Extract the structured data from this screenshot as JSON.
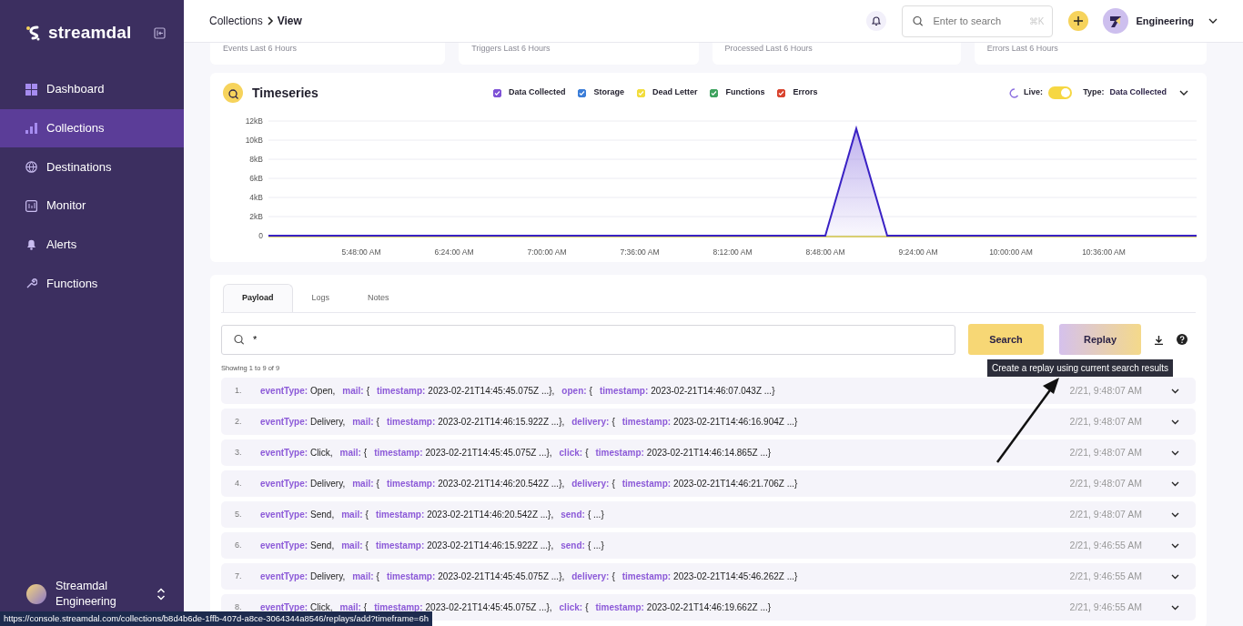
{
  "sidebar": {
    "brand": "streamdal",
    "items": [
      {
        "label": "Dashboard",
        "selected": false
      },
      {
        "label": "Collections",
        "selected": true
      },
      {
        "label": "Destinations",
        "selected": false
      },
      {
        "label": "Monitor",
        "selected": false
      },
      {
        "label": "Alerts",
        "selected": false
      },
      {
        "label": "Functions",
        "selected": false
      }
    ],
    "account": {
      "name": "Streamdal",
      "team": "Engineering"
    }
  },
  "header": {
    "breadcrumb": [
      "Collections",
      "View"
    ],
    "search": {
      "placeholder": "Enter to search",
      "shortcut": "⌘K"
    },
    "team": "Engineering"
  },
  "stats": [
    {
      "label": "Events Last 6 Hours"
    },
    {
      "label": "Triggers Last 6 Hours"
    },
    {
      "label": "Processed Last 6 Hours"
    },
    {
      "label": "Errors Last 6 Hours"
    }
  ],
  "timeseries": {
    "title": "Timeseries",
    "legend": [
      {
        "label": "Data Collected",
        "checked": true,
        "color": "#7e52d6"
      },
      {
        "label": "Storage",
        "checked": true,
        "color": "#3b7dd8"
      },
      {
        "label": "Dead Letter",
        "checked": true,
        "color": "#f2dd3c"
      },
      {
        "label": "Functions",
        "checked": true,
        "color": "#3fa35f"
      },
      {
        "label": "Errors",
        "checked": true,
        "color": "#d9442f"
      }
    ],
    "live": {
      "label": "Live:",
      "on": true
    },
    "type": {
      "label": "Type:",
      "value": "Data Collected"
    },
    "chart_data": {
      "type": "area",
      "x": [
        312,
        528,
        540,
        552,
        672
      ],
      "grid": true,
      "series": [
        {
          "color": "#3a22c4",
          "values": [
            0,
            0,
            11.2,
            0,
            0
          ]
        }
      ],
      "xlim": [
        312,
        672
      ],
      "ylim": [
        0,
        12
      ],
      "xticks": [
        {
          "value": 348,
          "label": "5:48:00 AM"
        },
        {
          "value": 384,
          "label": "6:24:00 AM"
        },
        {
          "value": 420,
          "label": "7:00:00 AM"
        },
        {
          "value": 456,
          "label": "7:36:00 AM"
        },
        {
          "value": 492,
          "label": "8:12:00 AM"
        },
        {
          "value": 528,
          "label": "8:48:00 AM"
        },
        {
          "value": 564,
          "label": "9:24:00 AM"
        },
        {
          "value": 600,
          "label": "10:00:00 AM"
        },
        {
          "value": 636,
          "label": "10:36:00 AM"
        }
      ],
      "yticks": [
        {
          "value": 0,
          "label": "0"
        },
        {
          "value": 2,
          "label": "2kB"
        },
        {
          "value": 4,
          "label": "4kB"
        },
        {
          "value": 6,
          "label": "6kB"
        },
        {
          "value": 8,
          "label": "8kB"
        },
        {
          "value": 10,
          "label": "10kB"
        },
        {
          "value": 12,
          "label": "12kB"
        }
      ]
    }
  },
  "payload": {
    "tabs": [
      {
        "label": "Payload",
        "selected": true
      },
      {
        "label": "Logs",
        "selected": false
      },
      {
        "label": "Notes",
        "selected": false
      }
    ],
    "search": {
      "value": "*"
    },
    "search_button": "Search",
    "replay_button": "Replay",
    "tooltip": "Create a replay using current search results",
    "showing": "Showing 1 to 9 of 9",
    "rows": [
      {
        "number": "1.",
        "segments": [
          {
            "kind": "key",
            "text": "eventType:"
          },
          {
            "kind": "value",
            "text": "Open,"
          },
          {
            "kind": "key",
            "text": "mail:"
          },
          {
            "kind": "value",
            "text": "{"
          },
          {
            "kind": "key",
            "text": "timestamp:"
          },
          {
            "kind": "value",
            "text": "2023-02-21T14:45:45.075Z ...},"
          },
          {
            "kind": "key",
            "text": "open:"
          },
          {
            "kind": "value",
            "text": "{"
          },
          {
            "kind": "key",
            "text": "timestamp:"
          },
          {
            "kind": "value",
            "text": "2023-02-21T14:46:07.043Z ...}"
          }
        ],
        "time": "2/21, 9:48:07 AM"
      },
      {
        "number": "2.",
        "segments": [
          {
            "kind": "key",
            "text": "eventType:"
          },
          {
            "kind": "value",
            "text": "Delivery,"
          },
          {
            "kind": "key",
            "text": "mail:"
          },
          {
            "kind": "value",
            "text": "{"
          },
          {
            "kind": "key",
            "text": "timestamp:"
          },
          {
            "kind": "value",
            "text": "2023-02-21T14:46:15.922Z ...},"
          },
          {
            "kind": "key",
            "text": "delivery:"
          },
          {
            "kind": "value",
            "text": "{"
          },
          {
            "kind": "key",
            "text": "timestamp:"
          },
          {
            "kind": "value",
            "text": "2023-02-21T14:46:16.904Z ...}"
          }
        ],
        "time": "2/21, 9:48:07 AM"
      },
      {
        "number": "3.",
        "segments": [
          {
            "kind": "key",
            "text": "eventType:"
          },
          {
            "kind": "value",
            "text": "Click,"
          },
          {
            "kind": "key",
            "text": "mail:"
          },
          {
            "kind": "value",
            "text": "{"
          },
          {
            "kind": "key",
            "text": "timestamp:"
          },
          {
            "kind": "value",
            "text": "2023-02-21T14:45:45.075Z ...},"
          },
          {
            "kind": "key",
            "text": "click:"
          },
          {
            "kind": "value",
            "text": "{"
          },
          {
            "kind": "key",
            "text": "timestamp:"
          },
          {
            "kind": "value",
            "text": "2023-02-21T14:46:14.865Z ...}"
          }
        ],
        "time": "2/21, 9:48:07 AM"
      },
      {
        "number": "4.",
        "segments": [
          {
            "kind": "key",
            "text": "eventType:"
          },
          {
            "kind": "value",
            "text": "Delivery,"
          },
          {
            "kind": "key",
            "text": "mail:"
          },
          {
            "kind": "value",
            "text": "{"
          },
          {
            "kind": "key",
            "text": "timestamp:"
          },
          {
            "kind": "value",
            "text": "2023-02-21T14:46:20.542Z ...},"
          },
          {
            "kind": "key",
            "text": "delivery:"
          },
          {
            "kind": "value",
            "text": "{"
          },
          {
            "kind": "key",
            "text": "timestamp:"
          },
          {
            "kind": "value",
            "text": "2023-02-21T14:46:21.706Z ...}"
          }
        ],
        "time": "2/21, 9:48:07 AM"
      },
      {
        "number": "5.",
        "segments": [
          {
            "kind": "key",
            "text": "eventType:"
          },
          {
            "kind": "value",
            "text": "Send,"
          },
          {
            "kind": "key",
            "text": "mail:"
          },
          {
            "kind": "value",
            "text": "{"
          },
          {
            "kind": "key",
            "text": "timestamp:"
          },
          {
            "kind": "value",
            "text": "2023-02-21T14:46:20.542Z ...},"
          },
          {
            "kind": "key",
            "text": "send:"
          },
          {
            "kind": "value",
            "text": "{  ...}"
          }
        ],
        "time": "2/21, 9:48:07 AM"
      },
      {
        "number": "6.",
        "segments": [
          {
            "kind": "key",
            "text": "eventType:"
          },
          {
            "kind": "value",
            "text": "Send,"
          },
          {
            "kind": "key",
            "text": "mail:"
          },
          {
            "kind": "value",
            "text": "{"
          },
          {
            "kind": "key",
            "text": "timestamp:"
          },
          {
            "kind": "value",
            "text": "2023-02-21T14:46:15.922Z ...},"
          },
          {
            "kind": "key",
            "text": "send:"
          },
          {
            "kind": "value",
            "text": "{  ...}"
          }
        ],
        "time": "2/21, 9:46:55 AM"
      },
      {
        "number": "7.",
        "segments": [
          {
            "kind": "key",
            "text": "eventType:"
          },
          {
            "kind": "value",
            "text": "Delivery,"
          },
          {
            "kind": "key",
            "text": "mail:"
          },
          {
            "kind": "value",
            "text": "{"
          },
          {
            "kind": "key",
            "text": "timestamp:"
          },
          {
            "kind": "value",
            "text": "2023-02-21T14:45:45.075Z ...},"
          },
          {
            "kind": "key",
            "text": "delivery:"
          },
          {
            "kind": "value",
            "text": "{"
          },
          {
            "kind": "key",
            "text": "timestamp:"
          },
          {
            "kind": "value",
            "text": "2023-02-21T14:45:46.262Z ...}"
          }
        ],
        "time": "2/21, 9:46:55 AM"
      },
      {
        "number": "8.",
        "segments": [
          {
            "kind": "key",
            "text": "eventType:"
          },
          {
            "kind": "value",
            "text": "Click,"
          },
          {
            "kind": "key",
            "text": "mail:"
          },
          {
            "kind": "value",
            "text": "{"
          },
          {
            "kind": "key",
            "text": "timestamp:"
          },
          {
            "kind": "value",
            "text": "2023-02-21T14:45:45.075Z ...},"
          },
          {
            "kind": "key",
            "text": "click:"
          },
          {
            "kind": "value",
            "text": "{"
          },
          {
            "kind": "key",
            "text": "timestamp:"
          },
          {
            "kind": "value",
            "text": "2023-02-21T14:46:19.662Z ...}"
          }
        ],
        "time": "2/21, 9:46:55 AM"
      }
    ]
  },
  "status_bar": {
    "url": "https://console.streamdal.com/collections/b8d4b6de-1ffb-407d-a8ce-3064344a8546/replays/add?timeframe=6h"
  }
}
